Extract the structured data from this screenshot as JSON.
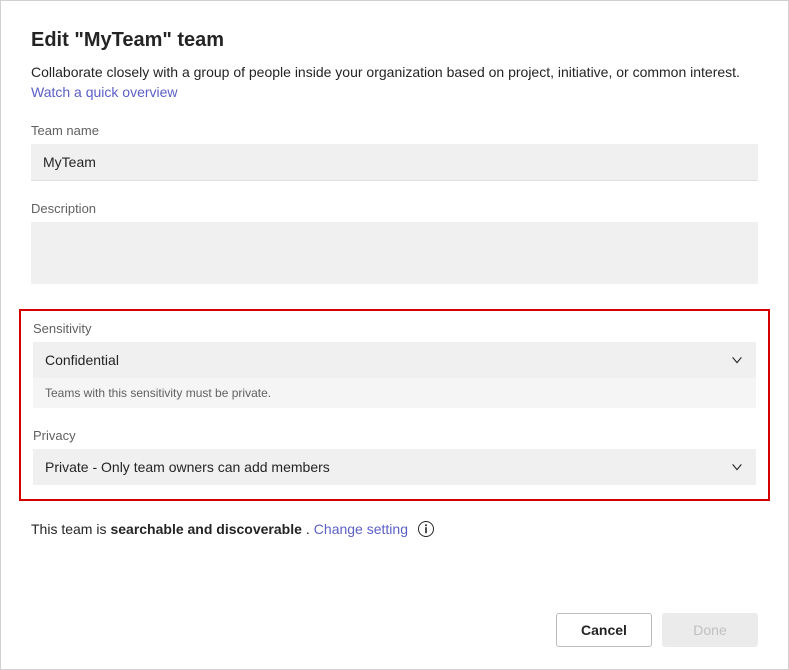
{
  "dialog": {
    "title": "Edit \"MyTeam\" team",
    "subtitle_prefix": "Collaborate closely with a group of people inside your organization based on project, initiative, or common interest. ",
    "overview_link": "Watch a quick overview"
  },
  "fields": {
    "team_name": {
      "label": "Team name",
      "value": "MyTeam"
    },
    "description": {
      "label": "Description",
      "value": ""
    },
    "sensitivity": {
      "label": "Sensitivity",
      "value": "Confidential",
      "helper": "Teams with this sensitivity must be private."
    },
    "privacy": {
      "label": "Privacy",
      "value": "Private - Only team owners can add members"
    }
  },
  "searchable": {
    "prefix": "This team is ",
    "bold": "searchable and discoverable",
    "suffix": ". ",
    "change_link": "Change setting"
  },
  "buttons": {
    "cancel": "Cancel",
    "done": "Done"
  }
}
